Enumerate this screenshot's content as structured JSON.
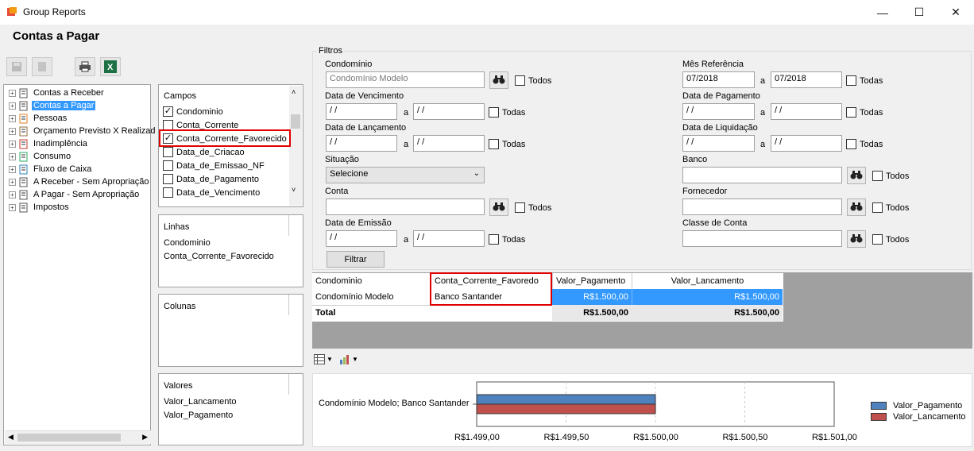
{
  "window": {
    "title": "Group Reports",
    "minimize": "—",
    "maximize": "☐",
    "close": "✕"
  },
  "page_title": "Contas a Pagar",
  "tree": {
    "items": [
      {
        "label": "Contas a Receber"
      },
      {
        "label": "Contas a Pagar",
        "selected": true
      },
      {
        "label": "Pessoas"
      },
      {
        "label": "Orçamento Previsto X Realizad"
      },
      {
        "label": "Inadimplência"
      },
      {
        "label": "Consumo"
      },
      {
        "label": "Fluxo de Caixa"
      },
      {
        "label": "A Receber - Sem Apropriação"
      },
      {
        "label": "A Pagar - Sem Apropriação"
      },
      {
        "label": "Impostos"
      }
    ]
  },
  "campos": {
    "title": "Campos",
    "items": [
      {
        "label": "Condominio",
        "checked": true
      },
      {
        "label": "Conta_Corrente",
        "checked": false
      },
      {
        "label": "Conta_Corrente_Favorecido",
        "checked": true
      },
      {
        "label": "Data_de_Criacao",
        "checked": false
      },
      {
        "label": "Data_de_Emissao_NF",
        "checked": false
      },
      {
        "label": "Data_de_Pagamento",
        "checked": false
      },
      {
        "label": "Data_de_Vencimento",
        "checked": false
      }
    ]
  },
  "linhas": {
    "title": "Linhas",
    "items": [
      "Condominio",
      "Conta_Corrente_Favorecido"
    ]
  },
  "colunas": {
    "title": "Colunas",
    "items": []
  },
  "valores": {
    "title": "Valores",
    "items": [
      "Valor_Lancamento",
      "Valor_Pagamento"
    ]
  },
  "filtros": {
    "title": "Filtros",
    "todos_label": "Todos",
    "todas_label": "Todas",
    "a_label": "a",
    "condominio": {
      "label": "Condomínio",
      "value": "Condomínio Modelo"
    },
    "data_vencimento": {
      "label": "Data de Vencimento",
      "from": " / /",
      "to": " / /"
    },
    "data_lancamento": {
      "label": "Data de Lançamento",
      "from": " / /",
      "to": " / /"
    },
    "situacao": {
      "label": "Situação",
      "value": "Selecione"
    },
    "conta": {
      "label": "Conta",
      "value": ""
    },
    "data_emissao": {
      "label": "Data de Emissão",
      "from": " / /",
      "to": " / /"
    },
    "mes_referencia": {
      "label": "Mês Referência",
      "from": "07/2018",
      "to": "07/2018"
    },
    "data_pagamento": {
      "label": "Data de Pagamento",
      "from": " / /",
      "to": " / /"
    },
    "data_liquidacao": {
      "label": "Data de Liquidação",
      "from": " / /",
      "to": " / /"
    },
    "banco": {
      "label": "Banco",
      "value": ""
    },
    "fornecedor": {
      "label": "Fornecedor",
      "value": ""
    },
    "classe_conta": {
      "label": "Classe de Conta",
      "value": ""
    },
    "filtrar_button": "Filtrar"
  },
  "grid": {
    "headers": [
      "Condominio",
      "Conta_Corrente_Favoredo",
      "Valor_Pagamento",
      "Valor_Lancamento"
    ],
    "row": [
      "Condomínio Modelo",
      "Banco Santander",
      "R$1.500,00",
      "R$1.500,00"
    ],
    "total": [
      "Total",
      "",
      "R$1.500,00",
      "R$1.500,00"
    ]
  },
  "chart_data": {
    "type": "bar",
    "orientation": "horizontal",
    "categories": [
      "Condomínio Modelo; Banco Santander"
    ],
    "series": [
      {
        "name": "Valor_Pagamento",
        "values": [
          1500.0
        ],
        "color": "#4f81bd"
      },
      {
        "name": "Valor_Lancamento",
        "values": [
          1500.0
        ],
        "color": "#c0504d"
      }
    ],
    "xlim": [
      1499.0,
      1501.0
    ],
    "x_ticks": [
      "R$1.499,00",
      "R$1.499,50",
      "R$1.500,00",
      "R$1.500,50",
      "R$1.501,00"
    ],
    "legend_position": "right",
    "grid": true
  }
}
